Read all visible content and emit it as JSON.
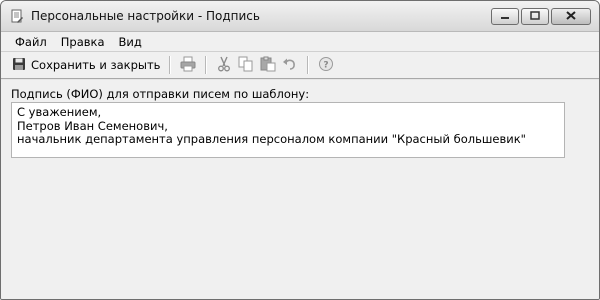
{
  "window": {
    "title": "Персональные настройки - Подпись",
    "controls": [
      "minimize-icon",
      "maximize-icon",
      "close-icon"
    ]
  },
  "menu": {
    "items": [
      "Файл",
      "Правка",
      "Вид"
    ]
  },
  "toolbar": {
    "save_label": "Сохранить и закрыть",
    "icons": [
      "save-icon",
      "print-icon",
      "cut-icon",
      "copy-icon",
      "paste-icon",
      "undo-icon",
      "help-icon"
    ]
  },
  "form": {
    "label": "Подпись (ФИО) для отправки писем по шаблону:",
    "signature_lines": [
      "С уважением,",
      "Петров Иван Семенович,",
      "начальник департамента управления персоналом компании \"Красный большевик\""
    ]
  }
}
